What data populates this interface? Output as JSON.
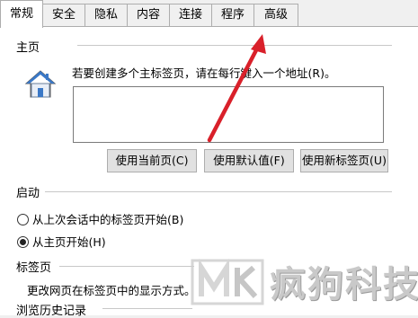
{
  "tabs": [
    {
      "label": "常规",
      "active": true
    },
    {
      "label": "安全",
      "active": false
    },
    {
      "label": "隐私",
      "active": false
    },
    {
      "label": "内容",
      "active": false
    },
    {
      "label": "连接",
      "active": false
    },
    {
      "label": "程序",
      "active": false
    },
    {
      "label": "高级",
      "active": false
    }
  ],
  "home": {
    "title": "主页",
    "hint": "若要创建多个主标签页，请在每行键入一个地址(R)。",
    "textarea_value": "",
    "buttons": {
      "use_current": "使用当前页(C)",
      "use_default": "使用默认值(F)",
      "use_new_tab": "使用新标签页(U)"
    }
  },
  "startup": {
    "title": "启动",
    "options": [
      {
        "label": "从上次会话中的标签页开始(B)",
        "checked": false
      },
      {
        "label": "从主页开始(H)",
        "checked": true
      }
    ]
  },
  "tabs_section": {
    "title": "标签页",
    "description": "更改网页在标签页中的显示方式。"
  },
  "history": {
    "title": "浏览历史记录"
  },
  "watermark": {
    "text": "疯狗科技"
  },
  "colors": {
    "arrow": "#d9202a",
    "icon_blue": "#3a78c7"
  }
}
